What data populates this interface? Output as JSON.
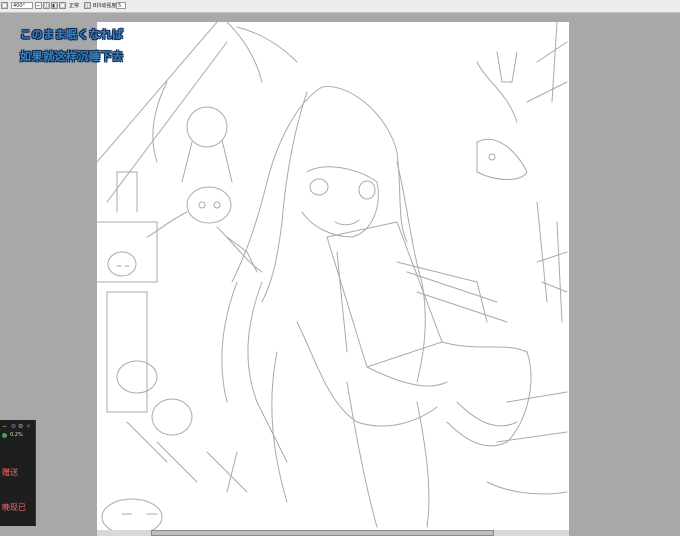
{
  "toolbar": {
    "zoom_value": "400°",
    "normal_label": "正常",
    "param_label": "B抖动强度",
    "param_value": "5",
    "buttons": [
      "□",
      "⌐",
      "◫",
      "◧"
    ]
  },
  "overlay": {
    "line1": "このまま眠くなれば",
    "line2": "如果就这样沉睡下去"
  },
  "side_panel": {
    "percent": "0.2%",
    "label1": "赠送",
    "label2": "晚现已"
  }
}
